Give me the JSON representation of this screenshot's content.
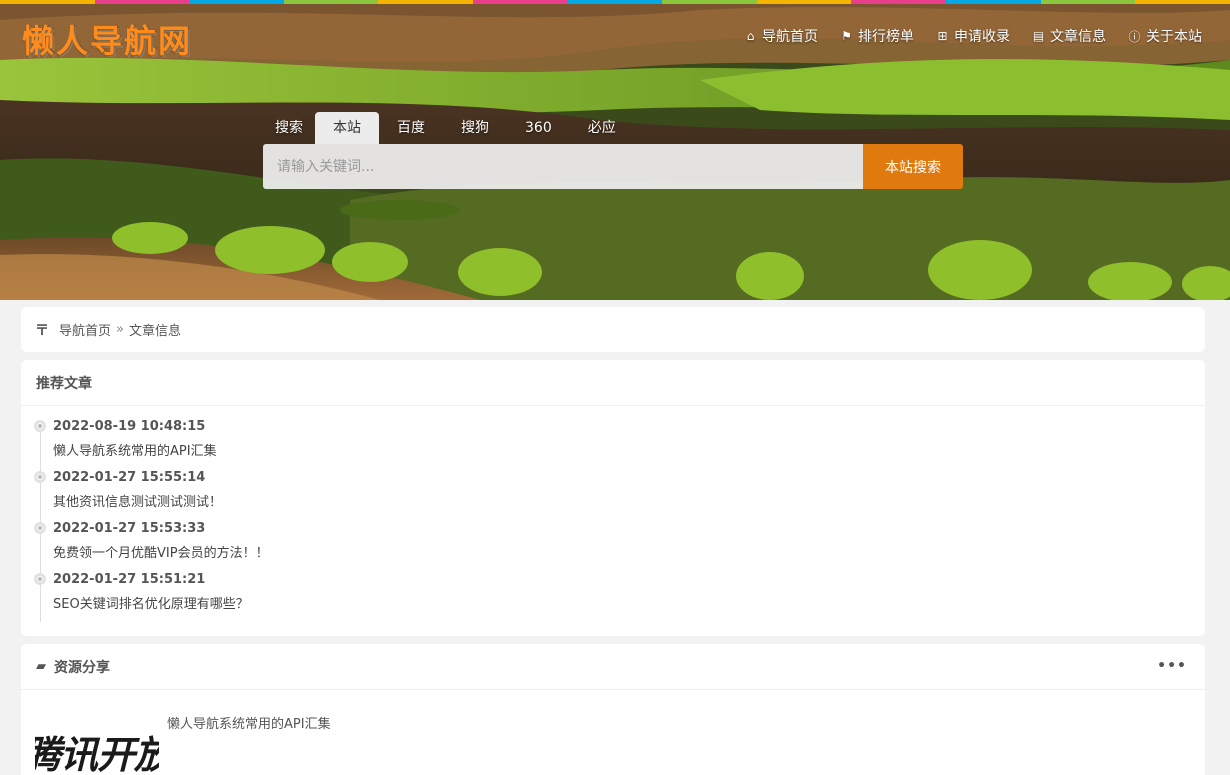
{
  "colors": {
    "stripe": [
      "#f5b400",
      "#e83e8c",
      "#00a8e6",
      "#8cc63f",
      "#f5b400",
      "#e83e8c",
      "#00a8e6",
      "#8cc63f",
      "#f5b400",
      "#e83e8c",
      "#00a8e6",
      "#8cc63f",
      "#f5b400"
    ],
    "accent": "#e07a0f",
    "logo": "#ff8c1a"
  },
  "header": {
    "logo": "懒人导航网",
    "nav": [
      {
        "icon": "home-icon",
        "label": "导航首页"
      },
      {
        "icon": "flag-icon",
        "label": "排行榜单"
      },
      {
        "icon": "plus-square-icon",
        "label": "申请收录"
      },
      {
        "icon": "book-icon",
        "label": "文章信息"
      },
      {
        "icon": "info-circle-icon",
        "label": "关于本站"
      }
    ]
  },
  "search": {
    "tabs": [
      "搜索",
      "本站",
      "百度",
      "搜狗",
      "360",
      "必应"
    ],
    "active_tab": "本站",
    "placeholder": "请输入关键词...",
    "button": "本站搜索"
  },
  "breadcrumb": {
    "icon": "tag-icon",
    "home": "导航首页",
    "separator": "»",
    "current": "文章信息"
  },
  "recommended": {
    "title": "推荐文章",
    "items": [
      {
        "time": "2022-08-19 10:48:15",
        "title": "懒人导航系统常用的API汇集"
      },
      {
        "time": "2022-01-27 15:55:14",
        "title": "其他资讯信息测试测试测试！"
      },
      {
        "time": "2022-01-27 15:53:33",
        "title": "免费领一个月优酷VIP会员的方法！！"
      },
      {
        "time": "2022-01-27 15:51:21",
        "title": "SEO关键词排名优化原理有哪些？"
      }
    ]
  },
  "resources": {
    "icon": "folder-open-icon",
    "title": "资源分享",
    "more": "•••",
    "thumb_text": "腾讯开放",
    "first_item": "懒人导航系统常用的API汇集"
  }
}
